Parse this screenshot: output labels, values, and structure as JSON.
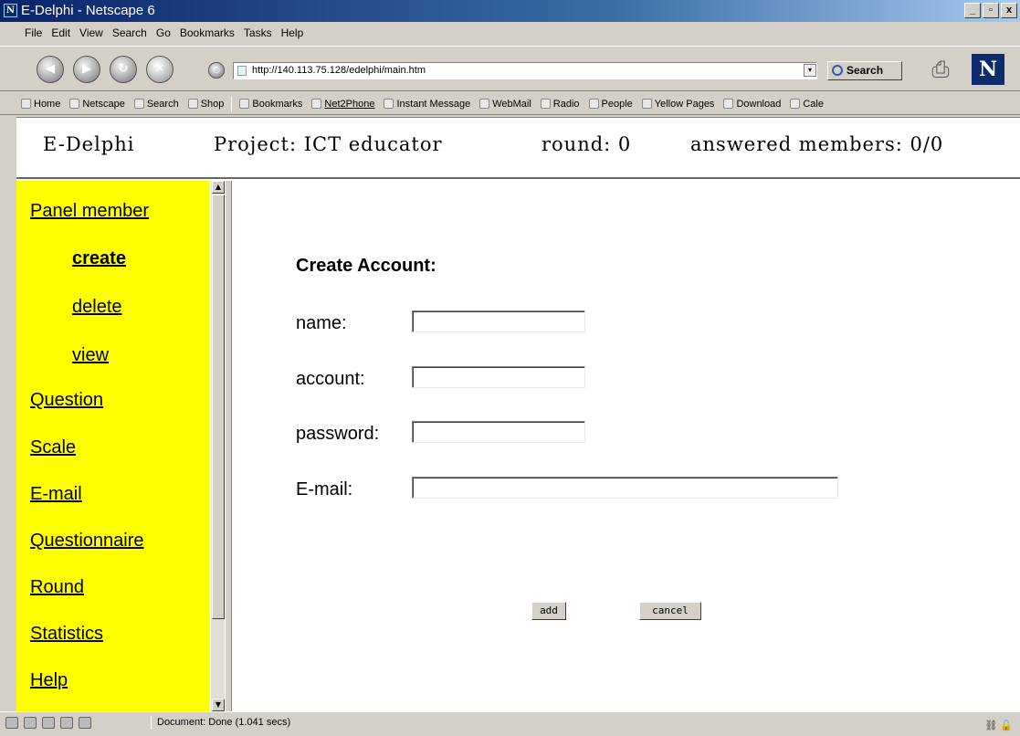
{
  "window": {
    "title": "E-Delphi - Netscape 6",
    "logo_letter": "N",
    "min": "_",
    "max": "▫",
    "close": "x"
  },
  "menubar": [
    "File",
    "Edit",
    "View",
    "Search",
    "Go",
    "Bookmarks",
    "Tasks",
    "Help"
  ],
  "navbar": {
    "url": "http://140.113.75.128/edelphi/main.htm",
    "search_label": "Search",
    "throbber_letter": "N"
  },
  "personal_toolbar": [
    {
      "label": "Home",
      "icon": "home-icon"
    },
    {
      "label": "Netscape",
      "icon": "netscape-icon"
    },
    {
      "label": "Search",
      "icon": "search-icon"
    },
    {
      "label": "Shop",
      "icon": "shop-icon"
    },
    {
      "label": "Bookmarks",
      "icon": "bookmarks-icon"
    },
    {
      "label": "Net2Phone",
      "icon": "net2phone-icon"
    },
    {
      "label": "Instant Message",
      "icon": "bookmark-icon"
    },
    {
      "label": "WebMail",
      "icon": "bookmark-icon"
    },
    {
      "label": "Radio",
      "icon": "bookmark-icon"
    },
    {
      "label": "People",
      "icon": "bookmark-icon"
    },
    {
      "label": "Yellow Pages",
      "icon": "bookmark-icon"
    },
    {
      "label": "Download",
      "icon": "bookmark-icon"
    },
    {
      "label": "Cale",
      "icon": "bookmark-icon"
    }
  ],
  "header": {
    "app": "E-Delphi",
    "project": "Project: ICT educator",
    "round": "round: 0",
    "answered": "answered members: 0/0"
  },
  "left_menu": {
    "panel_member": "Panel member",
    "create": "create",
    "delete": "delete",
    "view": "view",
    "question": "Question",
    "scale": "Scale",
    "email": "E-mail",
    "questionnaire": "Questionnaire",
    "round": "Round",
    "statistics": "Statistics",
    "help": "Help"
  },
  "form": {
    "heading": "Create Account:",
    "name_label": "name:",
    "account_label": "account:",
    "password_label": "password:",
    "email_label": "E-mail:",
    "name_value": "",
    "account_value": "",
    "password_value": "",
    "email_value": "",
    "add_label": "add",
    "cancel_label": "cancel"
  },
  "statusbar": {
    "text": "Document: Done (1.041 secs)"
  },
  "colors": {
    "left_frame_bg": "#ffff00",
    "chrome": "#d4d0c8",
    "title_bar": "#0a246a"
  }
}
